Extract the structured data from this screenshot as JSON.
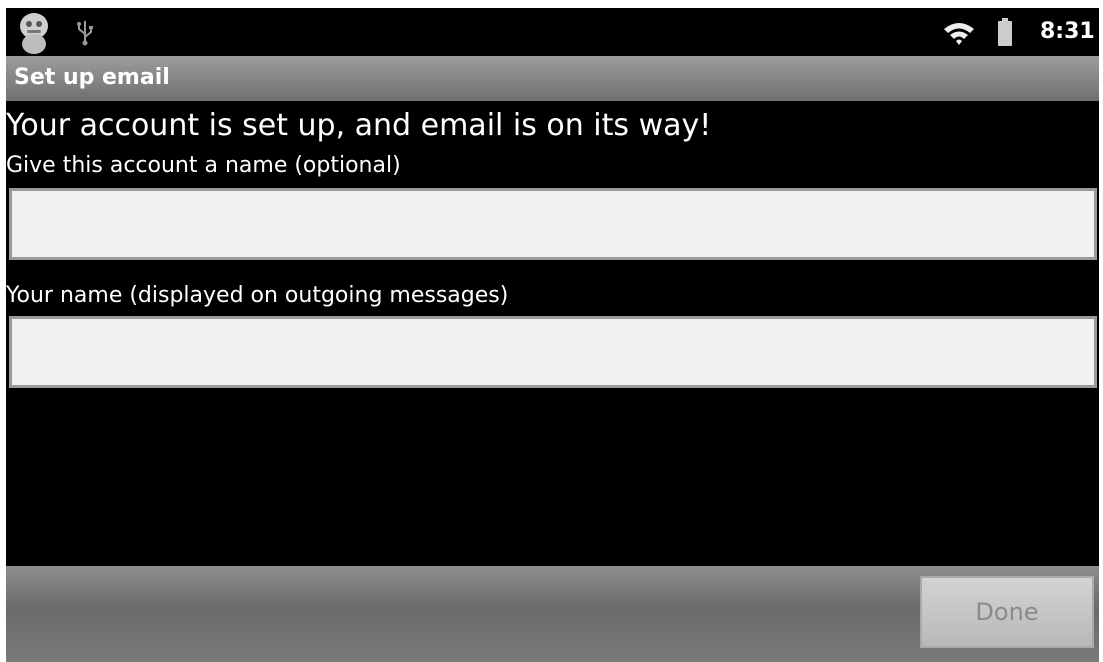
{
  "status_bar": {
    "time": "8:31",
    "icons": {
      "app": "android-robot-icon",
      "usb": "usb-icon",
      "wifi": "wifi-icon",
      "battery": "battery-icon"
    }
  },
  "title_bar": {
    "title": "Set up email"
  },
  "main": {
    "heading": "Your account is set up, and email is on its way!",
    "account_name": {
      "label": "Give this account a name (optional)",
      "value": "",
      "placeholder": ""
    },
    "your_name": {
      "label": "Your name (displayed on outgoing messages)",
      "value": "",
      "placeholder": ""
    }
  },
  "bottom_bar": {
    "done_label": "Done"
  },
  "colors": {
    "background": "#000000",
    "title_bar": "#8a8a8a",
    "field_background": "#f1f1f1",
    "done_text": "#8a8a8a"
  }
}
